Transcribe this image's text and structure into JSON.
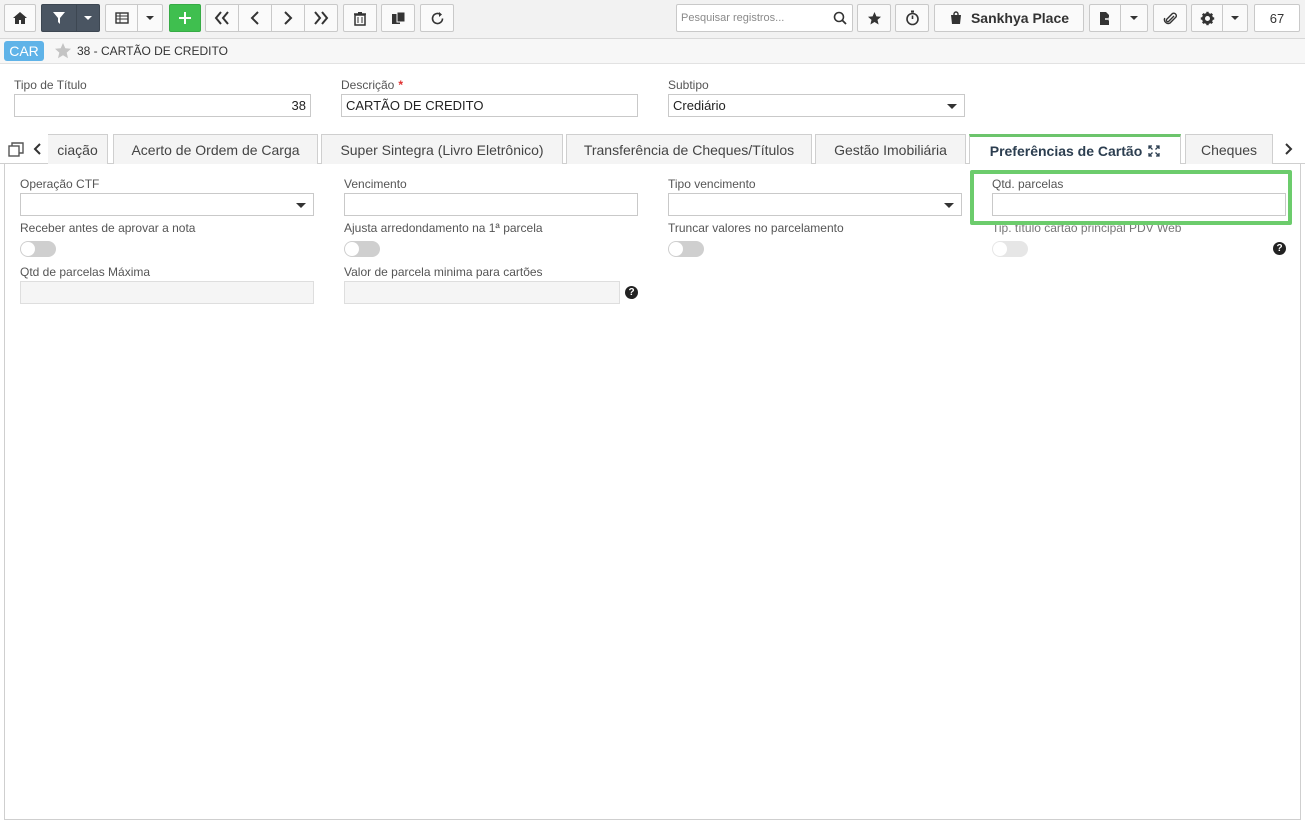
{
  "toolbar": {
    "search_placeholder": "Pesquisar registros...",
    "place_label": "Sankhya Place",
    "record_count": "67"
  },
  "breadcrumb": {
    "badge": "CAR",
    "title": "38 - CARTÃO DE CREDITO"
  },
  "header": {
    "tipo_titulo_label": "Tipo de Título",
    "tipo_titulo_value": "38",
    "descricao_label": "Descrição",
    "descricao_required": "*",
    "descricao_value": "CARTÃO DE CREDITO",
    "subtipo_label": "Subtipo",
    "subtipo_value": "Crediário"
  },
  "tabs": [
    {
      "label": "ciação"
    },
    {
      "label": "Acerto de Ordem de Carga"
    },
    {
      "label": "Super Sintegra (Livro Eletrônico)"
    },
    {
      "label": "Transferência de Cheques/Títulos"
    },
    {
      "label": "Gestão Imobiliária"
    },
    {
      "label": "Preferências de Cartão",
      "active": true
    },
    {
      "label": "Cheques"
    }
  ],
  "form": {
    "operacao_ctf_label": "Operação CTF",
    "vencimento_label": "Vencimento",
    "tipo_vencimento_label": "Tipo vencimento",
    "qtd_parcelas_label": "Qtd. parcelas",
    "receber_antes_label": "Receber antes de aprovar a nota",
    "ajusta_arred_label": "Ajusta arredondamento na 1ª parcela",
    "truncar_label": "Truncar valores no parcelamento",
    "tip_titulo_label": "Tip. título cartão principal PDV Web",
    "qtd_max_label": "Qtd de parcelas Máxima",
    "valor_min_label": "Valor de parcela minima para cartões",
    "help_glyph": "?"
  },
  "colors": {
    "accent_green": "#3fbf4f",
    "highlight_green": "#6ccc6c",
    "badge_blue": "#5fb3e8",
    "active_tab_border": "#6cc46c"
  }
}
